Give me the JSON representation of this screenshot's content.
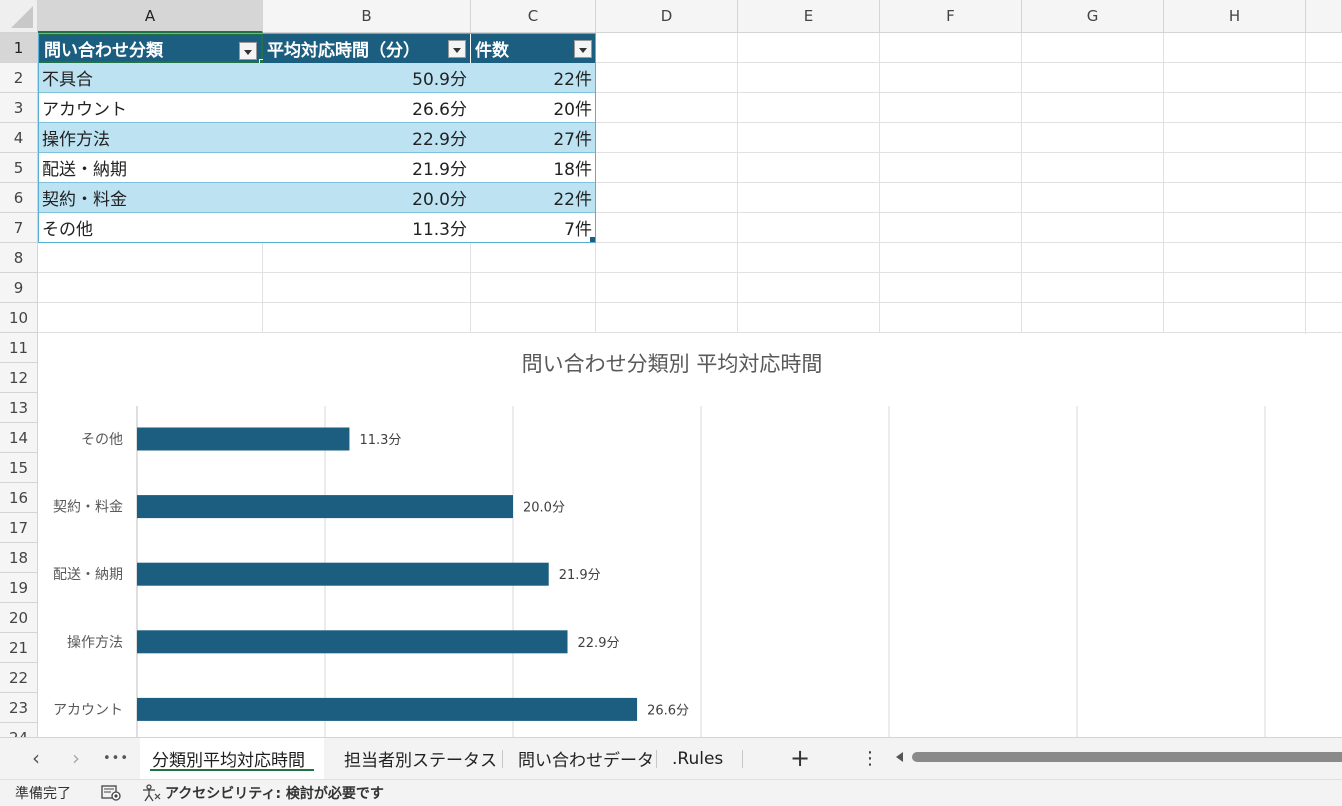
{
  "spreadsheet": {
    "columns": [
      "A",
      "B",
      "C",
      "D",
      "E",
      "F",
      "G",
      "H"
    ],
    "rows": [
      "1",
      "2",
      "3",
      "4",
      "5",
      "6",
      "7",
      "8",
      "9",
      "10",
      "11",
      "12",
      "13",
      "14",
      "15",
      "16",
      "17",
      "18",
      "19",
      "20",
      "21",
      "22",
      "23",
      "24"
    ],
    "table": {
      "headers": [
        "問い合わせ分類",
        "平均対応時間（分）",
        "件数"
      ],
      "rows": [
        [
          "不具合",
          "50.9分",
          "22件"
        ],
        [
          "アカウント",
          "26.6分",
          "20件"
        ],
        [
          "操作方法",
          "22.9分",
          "27件"
        ],
        [
          "配送・納期",
          "21.9分",
          "18件"
        ],
        [
          "契約・料金",
          "20.0分",
          "22件"
        ],
        [
          "その他",
          "11.3分",
          "7件"
        ]
      ]
    }
  },
  "chart_data": {
    "type": "bar",
    "orientation": "horizontal",
    "title": "問い合わせ分類別 平均対応時間",
    "categories": [
      "その他",
      "契約・料金",
      "配送・納期",
      "操作方法",
      "アカウント"
    ],
    "values": [
      11.3,
      20.0,
      21.9,
      22.9,
      26.6
    ],
    "labels": [
      "11.3分",
      "20.0分",
      "21.9分",
      "22.9分",
      "26.6分"
    ],
    "xlim": [
      0,
      60
    ],
    "grid": true,
    "bar_color": "#1b5e7f"
  },
  "tabs": {
    "nav_prev": "‹",
    "nav_next": "›",
    "more": "•••",
    "sheets": [
      "分類別平均対応時間",
      "担当者別ステータス",
      "問い合わせデータ",
      ".Rules"
    ],
    "active_index": 0,
    "add": "+",
    "options": "⋮"
  },
  "status": {
    "ready": "準備完了",
    "accessibility": "アクセシビリティ: 検討が必要です"
  },
  "colors": {
    "header_fill": "#1b5e7f",
    "band_fill": "#bde3f3",
    "accent": "#217346"
  }
}
